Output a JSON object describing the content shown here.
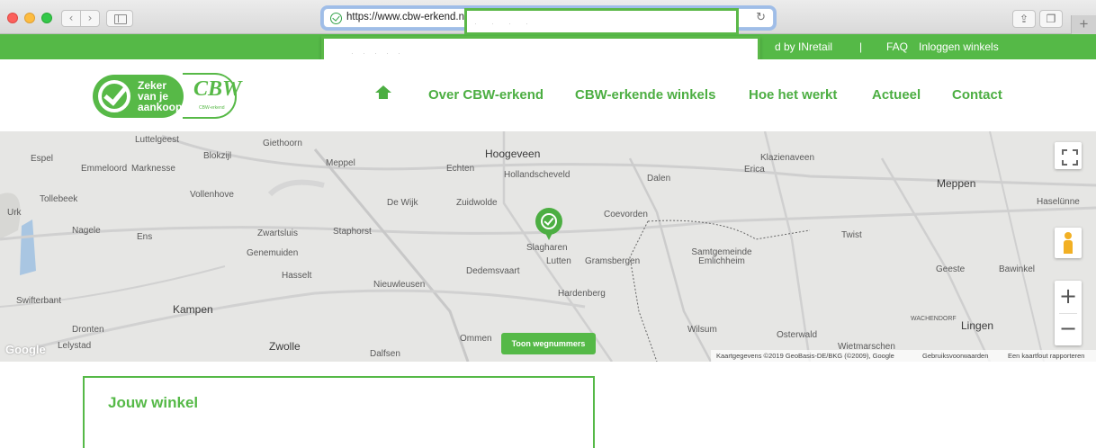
{
  "browser": {
    "url": "https://www.cbw-erkend.nl/",
    "icons": {
      "back": "chevron-left-icon",
      "forward": "chevron-right-icon",
      "sidebar": "sidebar-icon",
      "secure": "shield-check-icon",
      "reload": "reload-icon",
      "share": "share-icon",
      "tabs": "tab-overview-icon",
      "new_tab": "plus-icon"
    },
    "glyphs": {
      "back": "‹",
      "forward": "›",
      "reload": "↻",
      "share": "⇪",
      "tabs": "❐",
      "new_tab": "+"
    }
  },
  "topbar": {
    "inretail": "d by INretail",
    "separator": "|",
    "faq": "FAQ",
    "login": "Inloggen winkels",
    "color": "#55b947"
  },
  "logo": {
    "line1": "Zeker",
    "line2": "van je",
    "line3": "aankoop",
    "mark": "CBW",
    "small": "CBW-erkend",
    "icon": "check-circle-icon"
  },
  "nav": {
    "home_icon": "home-icon",
    "items": [
      "Over CBW-erkend",
      "CBW-erkende winkels",
      "Hoe het werkt",
      "Actueel",
      "Contact"
    ],
    "color": "#4cae42"
  },
  "map": {
    "places": [
      "Luttelgeest",
      "Giethoorn",
      "Espel",
      "Blokzijl",
      "Emmeloord",
      "Marknesse",
      "Meppel",
      "Echten",
      "Hoogeveen",
      "Hollandscheveld",
      "Klazienaveen",
      "Erica",
      "Dalen",
      "Meppen",
      "Tollebeek",
      "Vollenhove",
      "De Wijk",
      "Zuidwolde",
      "Coevorden",
      "Haselünne",
      "Urk",
      "Nagele",
      "Ens",
      "Zwartsluis",
      "Staphorst",
      "Slagharen",
      "Twist",
      "Genemuiden",
      "Lutten",
      "Gramsbergen",
      "Samtgemeinde Emlichheim",
      "Hasselt",
      "Dedemsvaart",
      "Geeste",
      "Bawinkel",
      "Nieuwleusen",
      "Hardenberg",
      "Swifterbant",
      "Kampen",
      "Dronten",
      "WACHENDORF",
      "Lingen",
      "Wilsum",
      "Osterwald",
      "Ommen",
      "Wietmarschen",
      "Lelystad",
      "Zwolle",
      "Dalfsen"
    ],
    "toon_button": "Toon wegnummers",
    "google": "Google",
    "attribution": {
      "data": "Kaartgegevens ©2019 GeoBasis-DE/BKG (©2009), Google",
      "terms": "Gebruiksvoorwaarden",
      "report": "Een kaartfout rapporteren"
    },
    "zoom_in": "+",
    "zoom_out": "−",
    "icons": {
      "fullscreen": "fullscreen-icon",
      "pegman": "pegman-icon",
      "pin": "map-pin-icon"
    }
  },
  "winkel": {
    "title": "Jouw winkel"
  }
}
